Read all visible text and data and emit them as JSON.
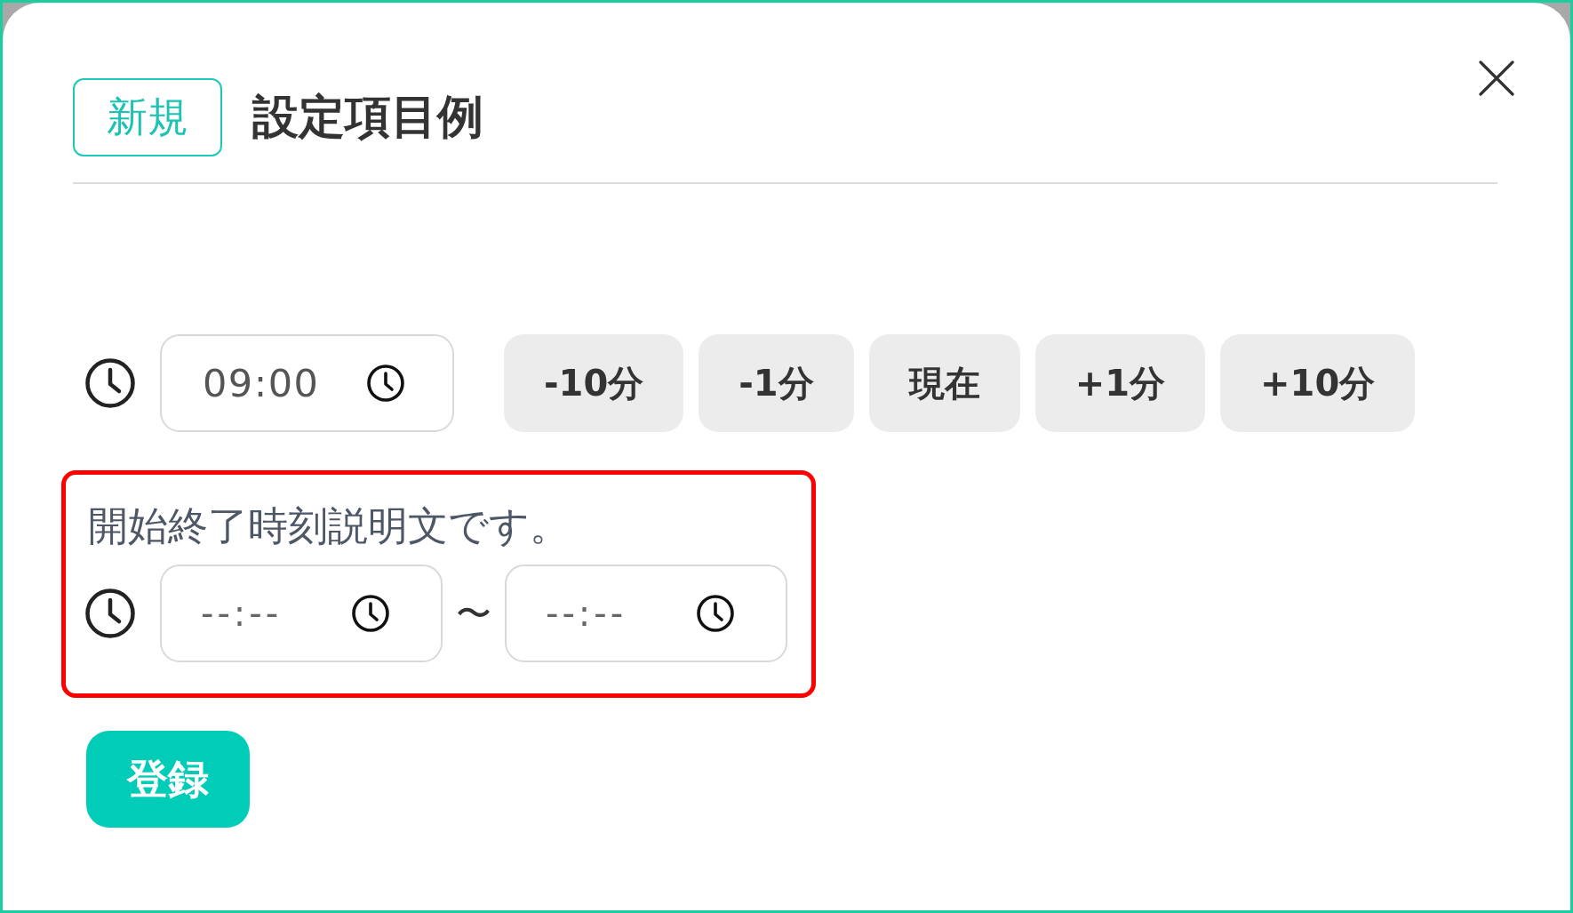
{
  "header": {
    "badge": "新規",
    "title": "設定項目例"
  },
  "time_field": {
    "value": "09:00"
  },
  "adjust_buttons": [
    "-10分",
    "-1分",
    "現在",
    "+1分",
    "+10分"
  ],
  "range": {
    "description": "開始終了時刻説明文です。",
    "start": {
      "placeholder": "--:--"
    },
    "separator": "〜",
    "end": {
      "placeholder": "--:--"
    }
  },
  "submit_button": "登録"
}
